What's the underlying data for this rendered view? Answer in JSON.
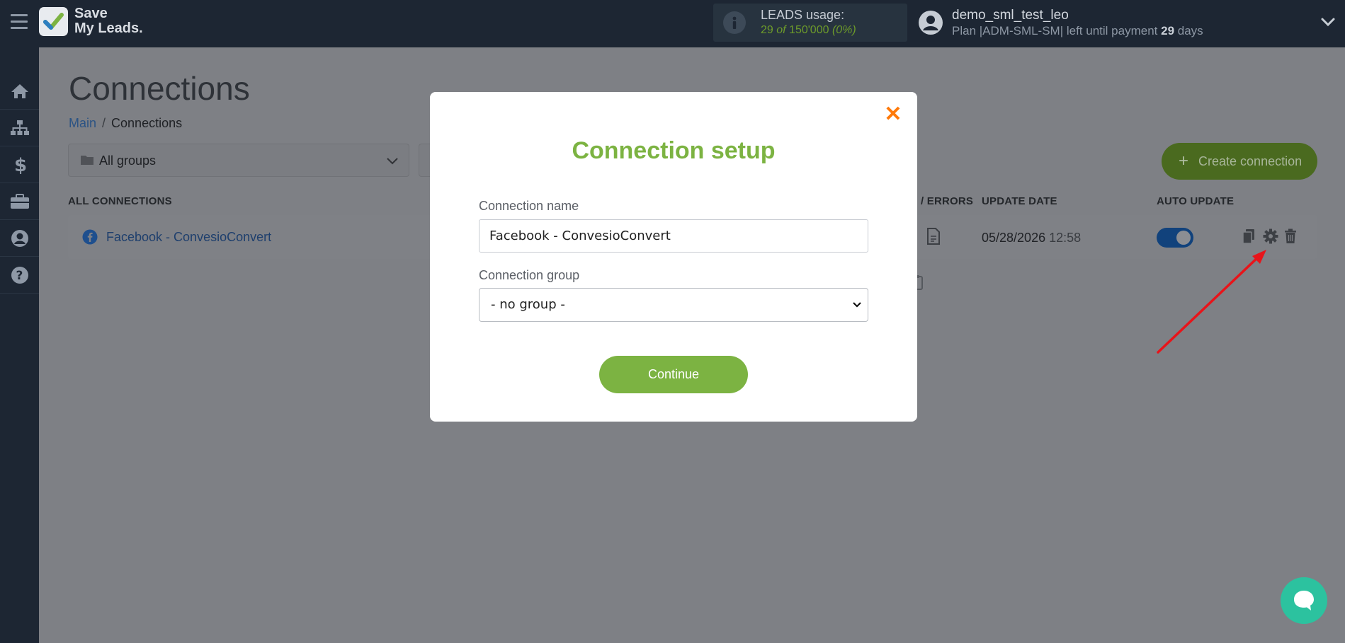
{
  "app": {
    "logo_line1": "Save",
    "logo_line2": "My Leads."
  },
  "usage": {
    "label": "LEADS usage:",
    "used": "29",
    "of": "of",
    "total": "150'000",
    "percent": "(0%)"
  },
  "user": {
    "name": "demo_sml_test_leo",
    "plan_prefix": "Plan |ADM-SML-SM| left until payment",
    "days_left": "29",
    "days_suffix": "days"
  },
  "sidebar": {
    "items": [
      {
        "icon": "home-icon"
      },
      {
        "icon": "sitemap-icon"
      },
      {
        "icon": "dollar-icon"
      },
      {
        "icon": "briefcase-icon"
      },
      {
        "icon": "user-icon"
      },
      {
        "icon": "help-icon"
      }
    ]
  },
  "page": {
    "title": "Connections",
    "breadcrumb_main": "Main",
    "breadcrumb_sep": "/",
    "breadcrumb_current": "Connections",
    "group_filter": "All groups",
    "create_button": "Create connection"
  },
  "table": {
    "headers": {
      "all": "ALL CONNECTIONS",
      "errors": "/ ERRORS",
      "update_date": "UPDATE DATE",
      "auto_update": "AUTO UPDATE"
    },
    "rows": [
      {
        "name": "Facebook - ConvesioConvert",
        "date": "05/28/2026",
        "time": "12:58",
        "auto_update": true
      }
    ]
  },
  "modal": {
    "title": "Connection setup",
    "name_label": "Connection name",
    "name_value": "Facebook - ConvesioConvert",
    "group_label": "Connection group",
    "group_value": "- no group -",
    "continue_label": "Continue"
  },
  "colors": {
    "accent_green": "#7cb342",
    "close_orange": "#ff7a0a",
    "topbar": "#1d2633",
    "chat": "#2cc29f"
  }
}
